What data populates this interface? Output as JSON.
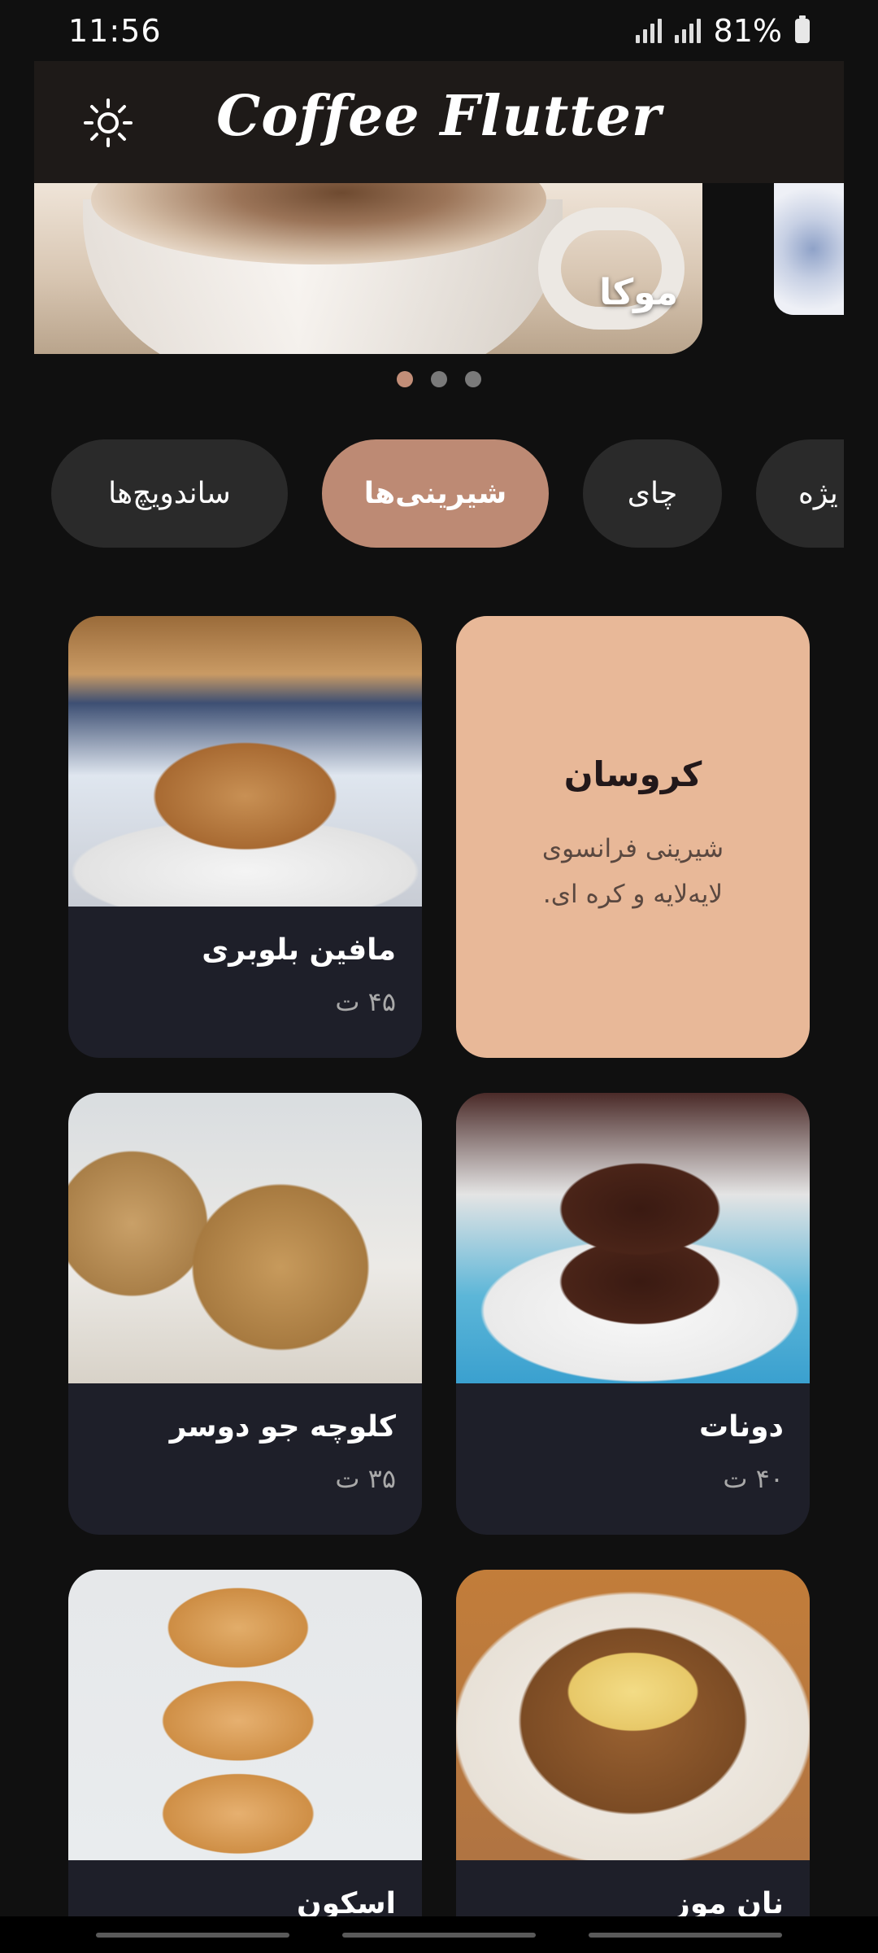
{
  "status_bar": {
    "time": "11:56",
    "battery": "81%"
  },
  "app_bar": {
    "title": "Coffee Flutter",
    "theme_icon": "sun-icon"
  },
  "carousel": {
    "current_label": "موکا",
    "page_count": 3,
    "active_index": 0
  },
  "categories": [
    {
      "label": "ساندویچ‌ها",
      "active": false
    },
    {
      "label": "شیرینی‌ها",
      "active": true
    },
    {
      "label": "چای",
      "active": false
    },
    {
      "label": "یژه",
      "active": false
    }
  ],
  "featured": {
    "title": "کروسان",
    "description": "شیرینی فرانسوی لایه‌لایه و کره ای."
  },
  "products": [
    {
      "name": "مافین بلوبری",
      "price": "۴۵ ت"
    },
    {
      "name": "دونات",
      "price": "۴۰ ت"
    },
    {
      "name": "کلوچه جو دوسر",
      "price": "۳۵ ت"
    },
    {
      "name": "نان موز",
      "price": ""
    },
    {
      "name": "اسکون",
      "price": ""
    }
  ],
  "colors": {
    "accent": "#bd8a74",
    "featured_bg": "#e8b898",
    "card_bg": "#1e1f29",
    "app_bar": "#1e1a18"
  }
}
